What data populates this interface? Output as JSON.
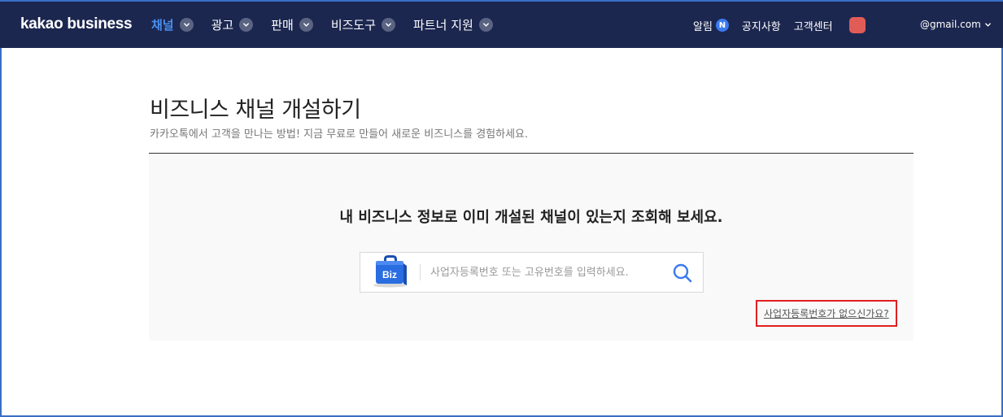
{
  "header": {
    "logo": "kakao business",
    "nav": [
      {
        "label": "채널",
        "active": true
      },
      {
        "label": "광고",
        "active": false
      },
      {
        "label": "판매",
        "active": false
      },
      {
        "label": "비즈도구",
        "active": false
      },
      {
        "label": "파트너 지원",
        "active": false
      }
    ],
    "alerts_label": "알림",
    "alerts_badge": "N",
    "notices_label": "공지사항",
    "support_label": "고객센터",
    "account_label": "@gmail.com"
  },
  "main": {
    "title": "비즈니스 채널 개설하기",
    "subtitle": "카카오톡에서 고객을 만나는 방법! 지금 무료로 만들어 새로운 비즈니스를 경험하세요.",
    "panel_title": "내 비즈니스 정보로 이미 개설된 채널이 있는지 조회해 보세요.",
    "search": {
      "icon_text": "Biz",
      "placeholder": "사업자등록번호 또는 고유번호를 입력하세요.",
      "value": ""
    },
    "no_biz_link": "사업자등록번호가 없으신가요?"
  },
  "colors": {
    "header_bg": "#1c2750",
    "active_nav": "#4a90f0",
    "badge": "#3a7af0",
    "avatar": "#e25c57",
    "highlight_border": "#e02020",
    "search_icon": "#3a7af0"
  }
}
